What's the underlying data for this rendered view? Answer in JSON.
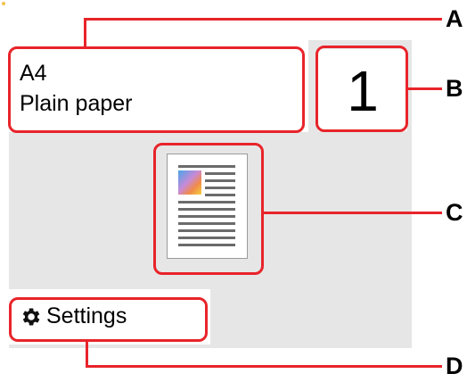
{
  "paper": {
    "size": "A4",
    "type": "Plain paper"
  },
  "copies": {
    "value": "1"
  },
  "settings": {
    "label": "Settings"
  },
  "callouts": {
    "a": "A",
    "b": "B",
    "c": "C",
    "d": "D"
  },
  "icons": {
    "settings": "gear-icon",
    "preview": "document-icon"
  },
  "colors": {
    "highlight": "#e8242a",
    "screen_bg": "#e6e6e6",
    "panel_bg": "#ffffff"
  }
}
